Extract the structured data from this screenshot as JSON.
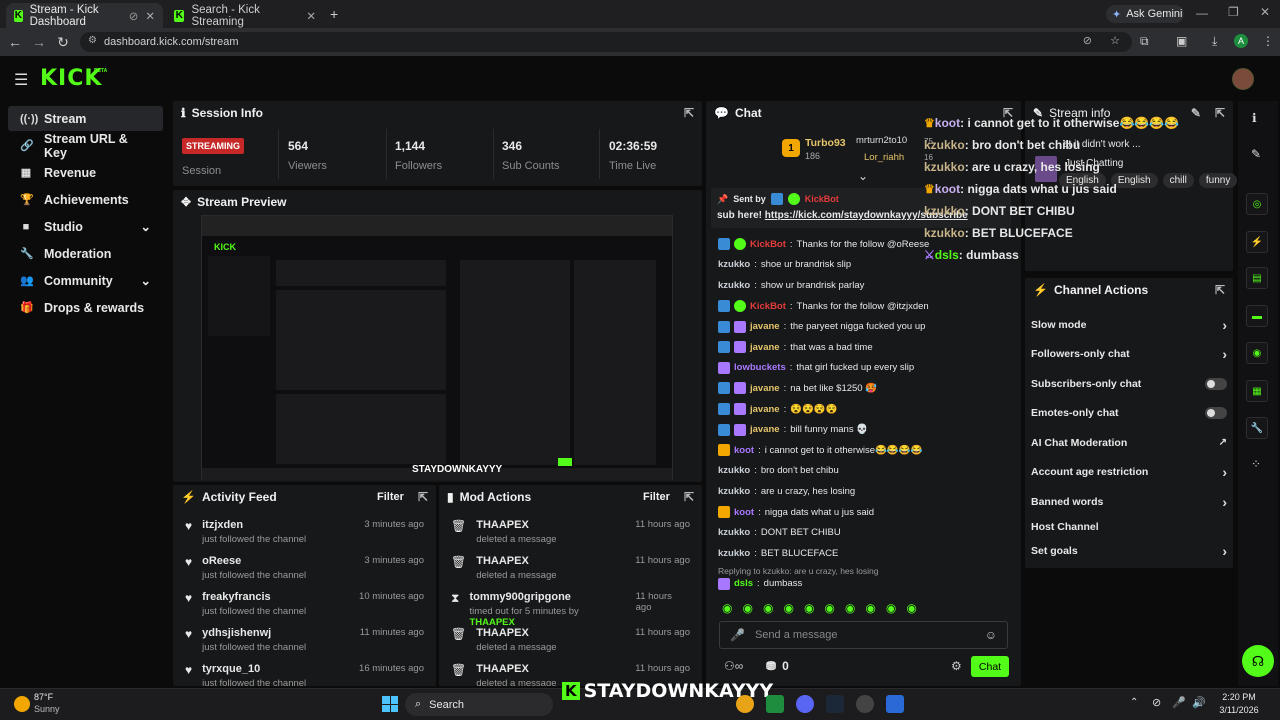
{
  "browser": {
    "tabs": [
      {
        "title": "Stream - Kick Dashboard"
      },
      {
        "title": "Search - Kick Streaming"
      }
    ],
    "ask_gemini": "Ask Gemini",
    "url": "dashboard.kick.com/stream",
    "profile_initial": "A"
  },
  "brand": {
    "logo": "KICK",
    "beta": "BETA"
  },
  "sidebar": {
    "items": [
      {
        "label": "Stream",
        "icon": "radio-icon"
      },
      {
        "label": "Stream URL & Key",
        "icon": "link-icon"
      },
      {
        "label": "Revenue",
        "icon": "chart-icon"
      },
      {
        "label": "Achievements",
        "icon": "trophy-icon"
      },
      {
        "label": "Studio",
        "icon": "camera-icon"
      },
      {
        "label": "Moderation",
        "icon": "wrench-icon"
      },
      {
        "label": "Community",
        "icon": "people-icon"
      },
      {
        "label": "Drops & rewards",
        "icon": "gift-icon"
      }
    ]
  },
  "session": {
    "title": "Session Info",
    "status": "STREAMING",
    "status_label": "Session",
    "viewers": "564",
    "viewers_label": "Viewers",
    "followers": "1,144",
    "followers_label": "Followers",
    "subs": "346",
    "subs_label": "Sub Counts",
    "time": "02:36:59",
    "time_label": "Time Live"
  },
  "preview": {
    "title": "Stream Preview",
    "watermark": "STAYDOWNKAYYY"
  },
  "activity": {
    "title": "Activity Feed",
    "filter": "Filter",
    "items": [
      {
        "name": "itzjxden",
        "sub": "just followed the channel",
        "time": "3 minutes ago"
      },
      {
        "name": "oReese",
        "sub": "just followed the channel",
        "time": "3 minutes ago"
      },
      {
        "name": "freakyfrancis",
        "sub": "just followed the channel",
        "time": "10 minutes ago"
      },
      {
        "name": "ydhsjishenwj",
        "sub": "just followed the channel",
        "time": "11 minutes ago"
      },
      {
        "name": "tyrxque_10",
        "sub": "just followed the channel",
        "time": "16 minutes ago"
      }
    ]
  },
  "modactions": {
    "title": "Mod Actions",
    "filter": "Filter",
    "items": [
      {
        "name": "THAAPEX",
        "sub": "deleted a message",
        "time": "11 hours ago"
      },
      {
        "name": "THAAPEX",
        "sub": "deleted a message",
        "time": "11 hours ago"
      },
      {
        "name": "tommy900gripgone",
        "sub": "timed out for 5 minutes by",
        "by": "THAAPEX",
        "time": "11 hours ago"
      },
      {
        "name": "THAAPEX",
        "sub": "deleted a message",
        "time": "11 hours ago"
      },
      {
        "name": "THAAPEX",
        "sub": "deleted a message",
        "time": "11 hours ago"
      }
    ]
  },
  "chat": {
    "title": "Chat",
    "leader": {
      "rank": "1",
      "name": "Turbo93",
      "count": "186",
      "user2": "mrturn2to10",
      "user2_count": "75",
      "user3": "Lor_riahh",
      "user3_count": "16"
    },
    "pinned": {
      "sent_by": "Sent by",
      "bot": "KickBot",
      "text": "sub here!",
      "link": "https://kick.com/staydownkayyy/subscribe"
    },
    "messages": [
      {
        "user": "KickBot",
        "text": "Thanks for the follow @oReese",
        "color": "#e53b3b"
      },
      {
        "user": "kzukko",
        "text": "shoe ur brandrisk slip",
        "color": "#c9d0d6"
      },
      {
        "user": "kzukko",
        "text": "show ur brandrisk parlay",
        "color": "#c9d0d6"
      },
      {
        "user": "KickBot",
        "text": "Thanks for the follow @itzjxden",
        "color": "#e53b3b"
      },
      {
        "user": "javane",
        "text": "the paryeet nigga fucked you up",
        "color": "#e4c46a"
      },
      {
        "user": "javane",
        "text": "that was a bad time",
        "color": "#e4c46a"
      },
      {
        "user": "lowbuckets",
        "text": "that girl fucked up every slip",
        "color": "#a879ff"
      },
      {
        "user": "javane",
        "text": "na bet like $1250 🥵",
        "color": "#e4c46a"
      },
      {
        "user": "javane",
        "text": "😵😵😵😵",
        "color": "#e4c46a"
      },
      {
        "user": "javane",
        "text": "bill funny mans 💀",
        "color": "#e4c46a"
      },
      {
        "user": "koot",
        "text": "i cannot get to it otherwise😂😂😂😂",
        "color": "#a879ff"
      },
      {
        "user": "kzukko",
        "text": "bro don't bet chibu",
        "color": "#c9d0d6"
      },
      {
        "user": "kzukko",
        "text": "are u crazy, hes losing",
        "color": "#c9d0d6"
      },
      {
        "user": "koot",
        "text": "nigga dats what u jus said",
        "color": "#a879ff"
      },
      {
        "user": "kzukko",
        "text": "DONT BET CHIBU",
        "color": "#c9d0d6"
      },
      {
        "user": "kzukko",
        "text": "BET BLUCEFACE",
        "color": "#c9d0d6"
      }
    ],
    "reply_to": "Replying to kzukko: are u crazy, hes losing",
    "reply": {
      "user": "dsls",
      "text": "dumbass"
    },
    "placeholder": "Send a message",
    "points": "0",
    "send": "Chat"
  },
  "overlay": [
    {
      "user": "koot",
      "text": "i cannot get to it otherwise😂😂😂😂"
    },
    {
      "user": "kzukko",
      "text": "bro don't bet chibu"
    },
    {
      "user": "kzukko",
      "text": "are u crazy, hes losing"
    },
    {
      "user": "koot",
      "text": "nigga dats what u jus said"
    },
    {
      "user": "kzukko",
      "text": "DONT BET CHIBU"
    },
    {
      "user": "kzukko",
      "text": "BET BLUCEFACE"
    },
    {
      "user": "dsls",
      "text": "dumbass"
    }
  ],
  "streaminfo": {
    "title": "Stream info",
    "partial_title": "at it didn't work ...",
    "category": "Just Chatting",
    "tags": [
      "English",
      "English",
      "chill",
      "funny"
    ]
  },
  "channelactions": {
    "title": "Channel Actions",
    "items": [
      {
        "label": "Slow mode",
        "ctl": "chevron"
      },
      {
        "label": "Followers-only chat",
        "ctl": "chevron"
      },
      {
        "label": "Subscribers-only chat",
        "ctl": "toggle"
      },
      {
        "label": "Emotes-only chat",
        "ctl": "toggle"
      },
      {
        "label": "AI Chat Moderation",
        "ctl": "external"
      },
      {
        "label": "Account age restriction",
        "ctl": "chevron"
      },
      {
        "label": "Banned words",
        "ctl": "chevron"
      },
      {
        "label": "Host Channel",
        "ctl": "none"
      },
      {
        "label": "Set goals",
        "ctl": "chevron"
      }
    ]
  },
  "taskbar": {
    "weather_temp": "87°F",
    "weather_desc": "Sunny",
    "search": "Search",
    "banner": "STAYDOWNKAYYY",
    "time": "2:20 PM",
    "date": "3/11/2026"
  },
  "colors": {
    "accent": "#53fc18",
    "streaming": "#e53b3b",
    "panel": "#17181a"
  }
}
